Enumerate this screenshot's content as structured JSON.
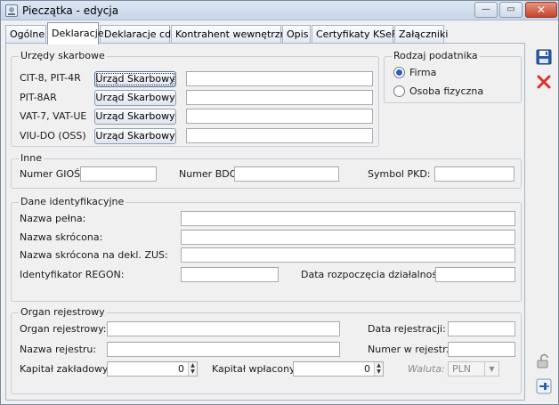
{
  "window": {
    "title": "Pieczątka - edycja",
    "minimize_glyph": "—",
    "maximize_glyph": "▭",
    "close_glyph": "✕"
  },
  "tabs": [
    "Ogólne",
    "Deklaracje",
    "Deklaracje cd.",
    "Kontrahent wewnętrzny",
    "Opis",
    "Certyfikaty KSeF",
    "Załączniki"
  ],
  "active_tab": "Deklaracje",
  "urzedy": {
    "legend": "Urzędy skarbowe",
    "button_label": "Urząd Skarbowy",
    "rows": [
      {
        "label": "CIT-8, PIT-4R",
        "value": ""
      },
      {
        "label": "PIT-8AR",
        "value": ""
      },
      {
        "label": "VAT-7, VAT-UE",
        "value": ""
      },
      {
        "label": "VIU-DO (OSS)",
        "value": ""
      }
    ]
  },
  "rodzaj": {
    "legend": "Rodzaj podatnika",
    "options": [
      "Firma",
      "Osoba fizyczna"
    ],
    "selected": "Firma"
  },
  "inne": {
    "legend": "Inne",
    "gios_label": "Numer GIOŚ:",
    "gios_value": "",
    "bdo_label": "Numer BDO:",
    "bdo_value": "",
    "pkd_label": "Symbol PKD:",
    "pkd_value": ""
  },
  "dane": {
    "legend": "Dane identyfikacyjne",
    "nazwa_pelna": "Nazwa pełna:",
    "nazwa_skrocona": "Nazwa skrócona:",
    "nazwa_zus": "Nazwa skrócona na dekl. ZUS:",
    "regon": "Identyfikator REGON:",
    "data_rozp": "Data rozpoczęcia działalności:"
  },
  "organ": {
    "legend": "Organ rejestrowy",
    "organ_label": "Organ rejestrowy:",
    "data_rej": "Data rejestracji:",
    "nazwa_rej": "Nazwa rejestru:",
    "numer_rej": "Numer w rejestrze",
    "kapital_zakl": "Kapitał zakładowy:",
    "kapital_zakl_value": "0",
    "kapital_wpl": "Kapitał wpłacony:",
    "kapital_wpl_value": "0",
    "waluta_label": "Waluta:",
    "waluta_value": "PLN"
  },
  "icons": {
    "save": "save-icon",
    "cancel": "cancel-icon",
    "lock": "lock-icon",
    "pin": "pin-icon"
  },
  "colors": {
    "title_bar": "#c6d5e8",
    "close_button": "#c4452a",
    "radio_selected": "#2d5fb7",
    "cancel_icon": "#d9342b",
    "save_icon": "#2b5ea8"
  }
}
